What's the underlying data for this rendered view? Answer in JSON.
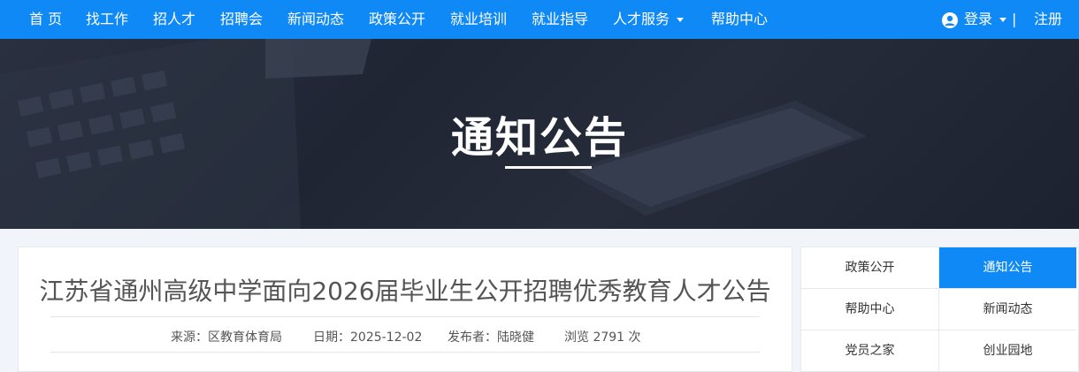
{
  "nav": {
    "items": [
      {
        "label": "首 页"
      },
      {
        "label": "找工作"
      },
      {
        "label": "招人才"
      },
      {
        "label": "招聘会"
      },
      {
        "label": "新闻动态"
      },
      {
        "label": "政策公开"
      },
      {
        "label": "就业培训"
      },
      {
        "label": "就业指导"
      },
      {
        "label": "人才服务"
      },
      {
        "label": "帮助中心"
      }
    ],
    "login": "登录",
    "separator": "|",
    "register": "注册",
    "icons": [
      "user-icon",
      "caret-down-icon"
    ]
  },
  "banner": {
    "title": "通知公告"
  },
  "article": {
    "title": "江苏省通州高级中学面向2026届毕业生公开招聘优秀教育人才公告",
    "source": "来源：区教育体育局",
    "date": "日期：2025-12-02",
    "publisher": "发布者：陆晓健",
    "views": "浏览 2791 次"
  },
  "sidebar": {
    "items": [
      {
        "label": "政策公开",
        "active": false
      },
      {
        "label": "通知公告",
        "active": true
      },
      {
        "label": "帮助中心",
        "active": false
      },
      {
        "label": "新闻动态",
        "active": false
      },
      {
        "label": "党员之家",
        "active": false
      },
      {
        "label": "创业园地",
        "active": false
      }
    ]
  },
  "colors": {
    "primary": "#0f89f5",
    "banner_dark": "#1f2533",
    "page_bg": "#f1f4f9"
  }
}
